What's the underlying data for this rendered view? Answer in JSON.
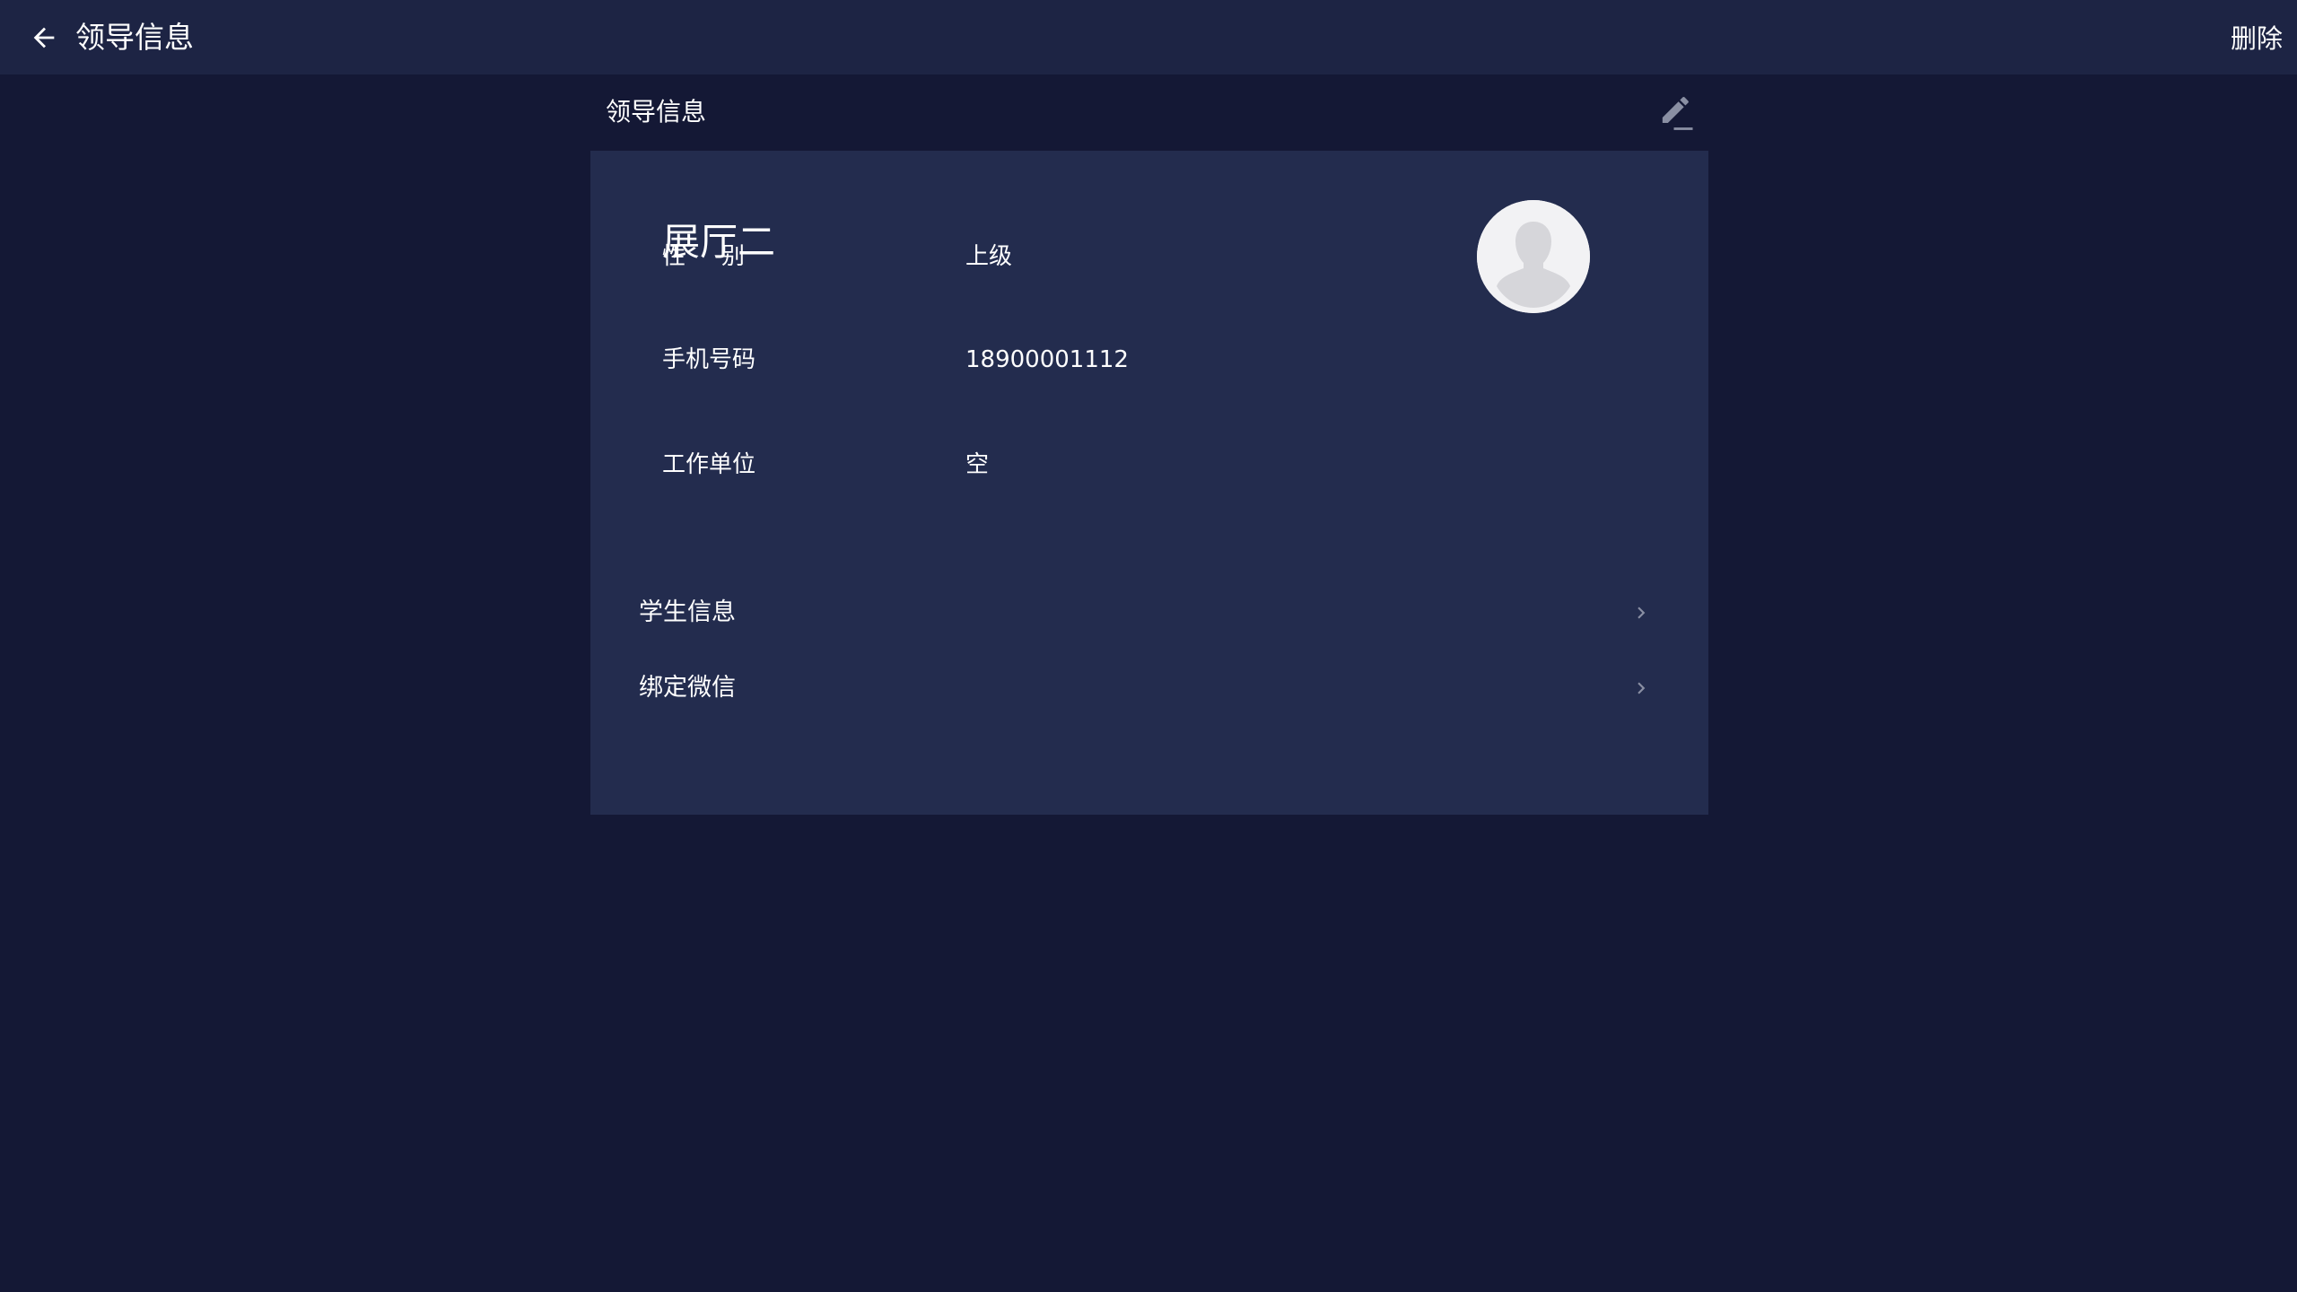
{
  "header": {
    "title": "领导信息",
    "delete_label": "删除"
  },
  "section": {
    "title": "领导信息"
  },
  "profile": {
    "name": "展厅二",
    "fields": [
      {
        "label": "性别",
        "value": "上级"
      },
      {
        "label": "手机号码",
        "value": "18900001112"
      },
      {
        "label": "工作单位",
        "value": "空"
      }
    ]
  },
  "links": [
    {
      "label": "学生信息"
    },
    {
      "label": "绑定微信"
    }
  ],
  "icons": {
    "back": "arrow-left-icon",
    "edit": "pencil-icon",
    "avatar": "default-avatar-icon",
    "chevron": "chevron-right-icon"
  },
  "colors": {
    "background": "#141835",
    "topbar": "#1d2444",
    "card": "#232c4e",
    "text": "#ffffff",
    "icon_muted": "#8a8fa3"
  }
}
